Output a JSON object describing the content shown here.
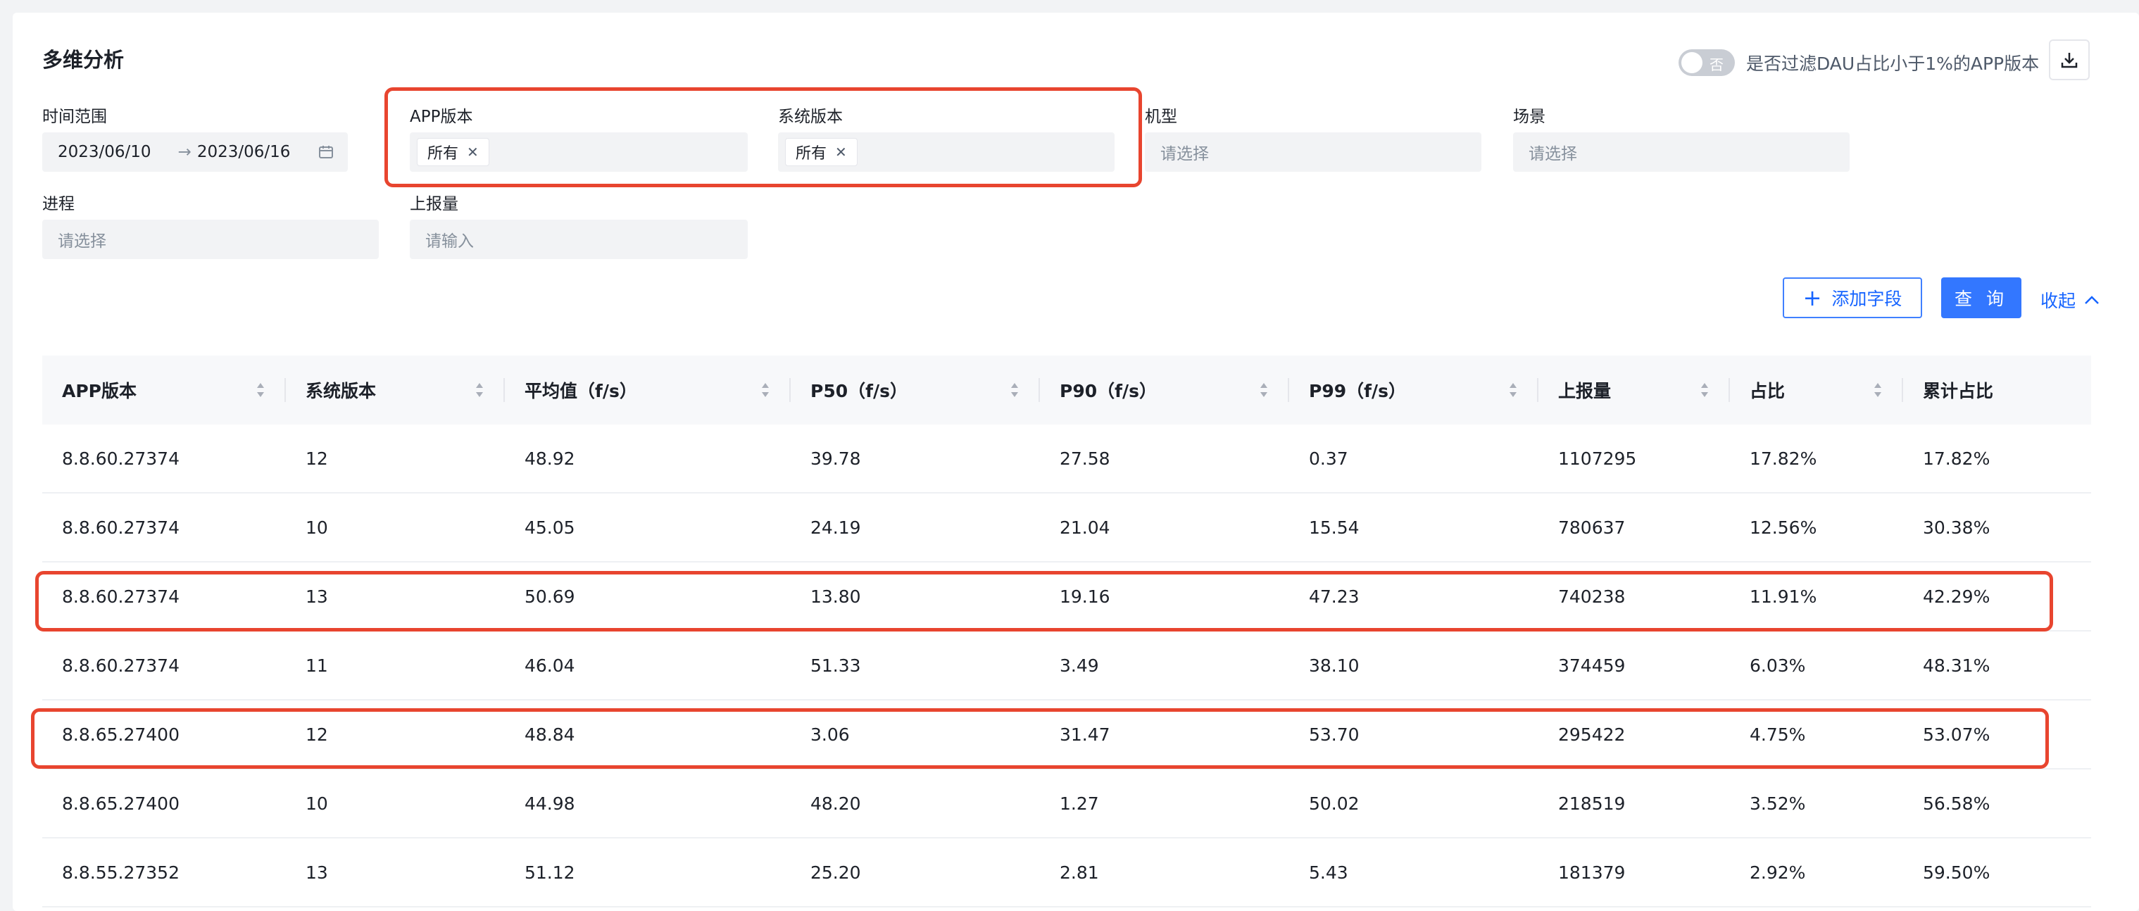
{
  "page": {
    "title": "多维分析",
    "toggle": {
      "state_text": "否",
      "label": "是否过滤DAU占比小于1%的APP版本"
    }
  },
  "filters": {
    "time_range": {
      "label": "时间范围",
      "start": "2023/06/10",
      "end": "2023/06/16"
    },
    "app_version": {
      "label": "APP版本",
      "tag": "所有"
    },
    "os_version": {
      "label": "系统版本",
      "tag": "所有"
    },
    "model": {
      "label": "机型",
      "placeholder": "请选择"
    },
    "scene": {
      "label": "场景",
      "placeholder": "请选择"
    },
    "process": {
      "label": "进程",
      "placeholder": "请选择"
    },
    "report_count": {
      "label": "上报量",
      "placeholder": "请输入"
    }
  },
  "actions": {
    "add_field": "添加字段",
    "query": "查 询",
    "collapse": "收起"
  },
  "table": {
    "columns": [
      "APP版本",
      "系统版本",
      "平均值（f/s）",
      "P50（f/s）",
      "P90（f/s）",
      "P99（f/s）",
      "上报量",
      "占比",
      "累计占比"
    ],
    "rows": [
      [
        "8.8.60.27374",
        "12",
        "48.92",
        "39.78",
        "27.58",
        "0.37",
        "1107295",
        "17.82%",
        "17.82%"
      ],
      [
        "8.8.60.27374",
        "10",
        "45.05",
        "24.19",
        "21.04",
        "15.54",
        "780637",
        "12.56%",
        "30.38%"
      ],
      [
        "8.8.60.27374",
        "13",
        "50.69",
        "13.80",
        "19.16",
        "47.23",
        "740238",
        "11.91%",
        "42.29%"
      ],
      [
        "8.8.60.27374",
        "11",
        "46.04",
        "51.33",
        "3.49",
        "38.10",
        "374459",
        "6.03%",
        "48.31%"
      ],
      [
        "8.8.65.27400",
        "12",
        "48.84",
        "3.06",
        "31.47",
        "53.70",
        "295422",
        "4.75%",
        "53.07%"
      ],
      [
        "8.8.65.27400",
        "10",
        "44.98",
        "48.20",
        "1.27",
        "50.02",
        "218519",
        "3.52%",
        "56.58%"
      ],
      [
        "8.8.55.27352",
        "13",
        "51.12",
        "25.20",
        "2.81",
        "5.43",
        "181379",
        "2.92%",
        "59.50%"
      ]
    ]
  },
  "theme": {
    "accent": "#3377ff",
    "highlight": "#e8452f"
  }
}
